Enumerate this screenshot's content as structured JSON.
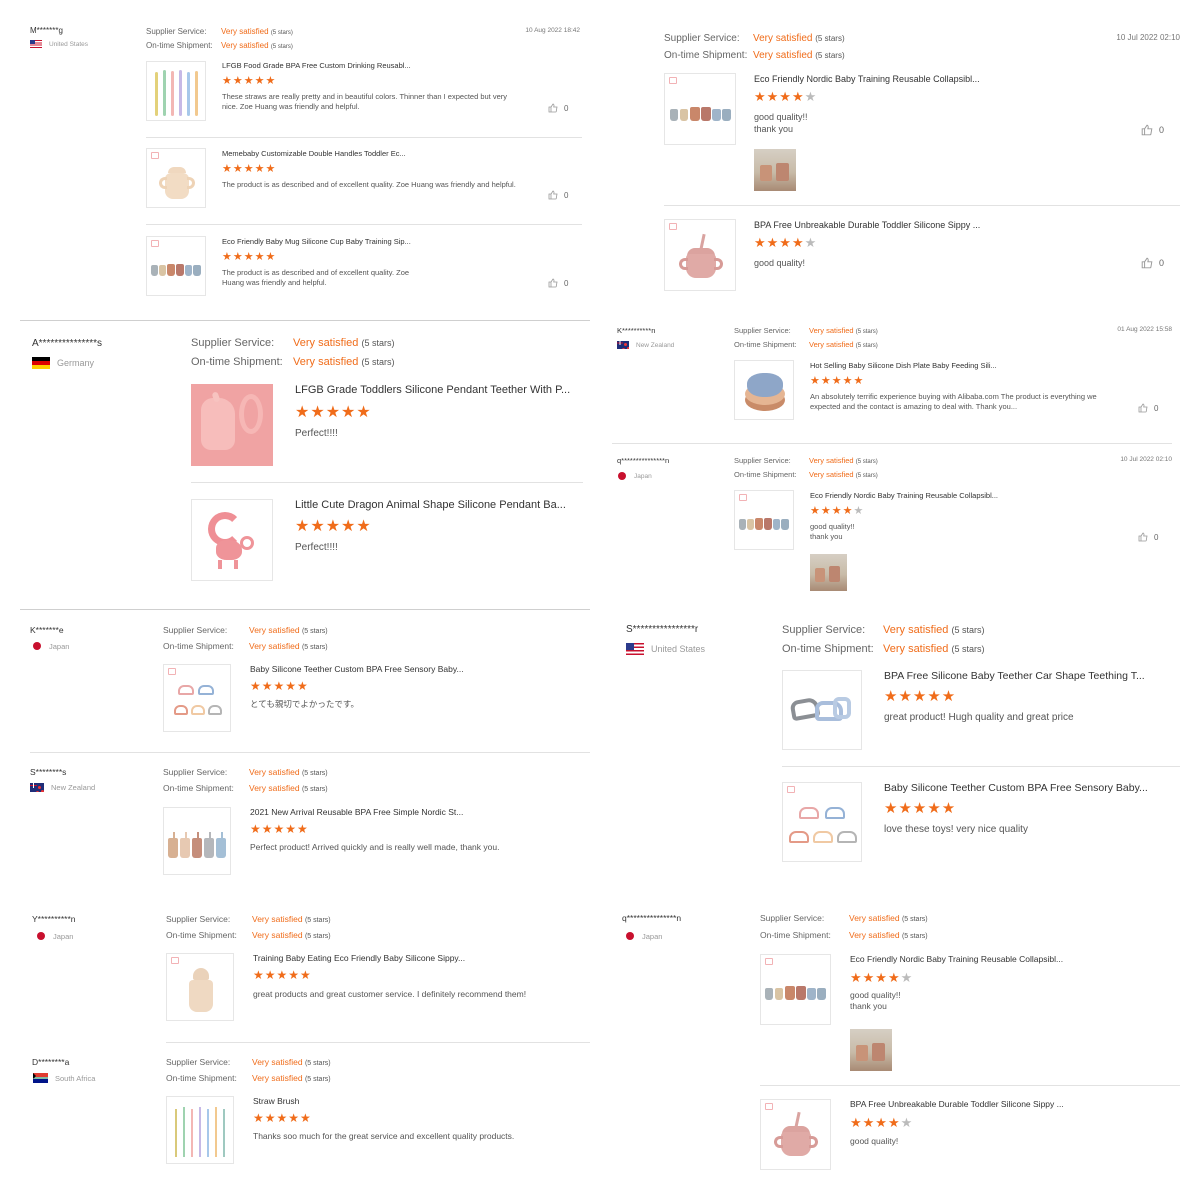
{
  "labels": {
    "supplier_service": "Supplier Service:",
    "ontime_shipment": "On-time Shipment:",
    "very_satisfied": "Very satisfied",
    "five_stars": "(5 stars)"
  },
  "colors": {
    "accent": "#f06c1a",
    "star_off": "#bbbbbb",
    "separator": "#e2e2e2"
  },
  "reviews": [
    {
      "user": "M*******g",
      "country": "United States",
      "flag": "us-flag",
      "date": "10 Aug 2022 18:42",
      "items": [
        {
          "title": "LFGB Food Grade BPA Free Custom Drinking Reusabl...",
          "stars": 5,
          "comment": "These straws are really pretty and in beautiful colors. Thinner than I expected but very nice. Zoe Huang was friendly and helpful.",
          "likes": "0"
        },
        {
          "title": "Memebaby Customizable Double Handles Toddler Ec...",
          "stars": 5,
          "comment": "The product is as described and of excellent quality. Zoe Huang was friendly and helpful.",
          "likes": "0"
        },
        {
          "title": "Eco Friendly Baby Mug Silicone Cup Baby Training Sip...",
          "stars": 5,
          "comment": "The product is as described and of excellent quality. Zoe Huang was friendly and helpful.",
          "likes": "0"
        }
      ]
    },
    {
      "user": "",
      "country": "",
      "flag": "",
      "date": "10 Jul 2022 02:10",
      "items": [
        {
          "title": "Eco Friendly Nordic Baby Training Reusable Collapsibl...",
          "stars": 4,
          "comment": "good quality!! thank you",
          "likes": "0"
        },
        {
          "title": "BPA Free Unbreakable Durable Toddler Silicone Sippy ...",
          "stars": 4,
          "comment": "good quality!",
          "likes": "0"
        }
      ]
    },
    {
      "user": "A***************s",
      "country": "Germany",
      "flag": "germany-flag",
      "date": "",
      "items": [
        {
          "title": "LFGB Grade Toddlers Silicone Pendant Teether With P...",
          "stars": 5,
          "comment": "Perfect!!!!"
        },
        {
          "title": "Little Cute Dragon Animal Shape Silicone Pendant Ba...",
          "stars": 5,
          "comment": "Perfect!!!!"
        }
      ]
    },
    {
      "user": "K**********n",
      "country": "New Zealand",
      "flag": "new-zealand-flag",
      "date": "01 Aug 2022 15:58",
      "items": [
        {
          "title": "Hot Selling Baby Silicone Dish Plate Baby Feeding Sili...",
          "stars": 5,
          "comment": "An absolutely terrific experience buying with Alibaba.com The product is everything we expected and the contact is amazing to deal with. Thank you...",
          "likes": "0"
        }
      ]
    },
    {
      "user": "q***************n",
      "country": "Japan",
      "flag": "japan-flag",
      "date": "10 Jul 2022 02:10",
      "items": [
        {
          "title": "Eco Friendly Nordic Baby Training Reusable Collapsibl...",
          "stars": 4,
          "comment": "good quality!! thank you",
          "likes": "0"
        }
      ]
    },
    {
      "user": "K*******e",
      "country": "Japan",
      "flag": "japan-flag",
      "date": "",
      "items": [
        {
          "title": "Baby Silicone Teether Custom BPA Free Sensory Baby...",
          "stars": 5,
          "comment": "とても親切でよかったです。"
        }
      ]
    },
    {
      "user": "S****************r",
      "country": "United States",
      "flag": "us-flag",
      "date": "",
      "items": [
        {
          "title": "BPA Free Silicone Baby Teether Car Shape Teething T...",
          "stars": 5,
          "comment": "great product! Hugh quality and great price"
        },
        {
          "title": "Baby Silicone Teether Custom BPA Free Sensory Baby...",
          "stars": 5,
          "comment": "love these toys! very nice quality"
        }
      ]
    },
    {
      "user": "S********s",
      "country": "New Zealand",
      "flag": "new-zealand-flag",
      "date": "",
      "items": [
        {
          "title": "2021 New Arrival Reusable BPA Free Simple Nordic St...",
          "stars": 5,
          "comment": "Perfect product! Arrived quickly and is really well made, thank you."
        }
      ]
    },
    {
      "user": "Y**********n",
      "country": "Japan",
      "flag": "japan-flag",
      "date": "",
      "items": [
        {
          "title": "Training Baby Eating Eco Friendly Baby Silicone Sippy...",
          "stars": 5,
          "comment": "great products and great customer service. I definitely recommend them!"
        }
      ]
    },
    {
      "user": "q***************n",
      "country": "Japan",
      "flag": "japan-flag",
      "date": "",
      "items": [
        {
          "title": "Eco Friendly Nordic Baby Training Reusable Collapsibl...",
          "stars": 4,
          "comment": "good quality!! thank you"
        },
        {
          "title": "BPA Free Unbreakable Durable Toddler Silicone Sippy ...",
          "stars": 4,
          "comment": "good quality!"
        }
      ]
    },
    {
      "user": "D********a",
      "country": "South Africa",
      "flag": "south-africa-flag",
      "date": "",
      "items": [
        {
          "title": "Straw Brush",
          "stars": 5,
          "comment": "Thanks soo much for the great service and excellent quality products."
        }
      ]
    }
  ]
}
